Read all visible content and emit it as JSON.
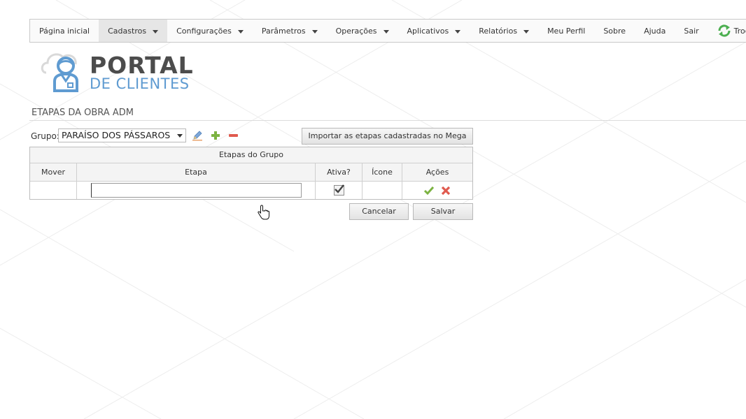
{
  "nav": {
    "items": [
      {
        "label": "Página inicial",
        "caret": false,
        "active": false
      },
      {
        "label": "Cadastros",
        "caret": true,
        "active": true
      },
      {
        "label": "Configurações",
        "caret": true,
        "active": false
      },
      {
        "label": "Parâmetros",
        "caret": true,
        "active": false
      },
      {
        "label": "Operações",
        "caret": true,
        "active": false
      },
      {
        "label": "Aplicativos",
        "caret": true,
        "active": false
      },
      {
        "label": "Relatórios",
        "caret": true,
        "active": false
      },
      {
        "label": "Meu Perfil",
        "caret": false,
        "active": false
      },
      {
        "label": "Sobre",
        "caret": false,
        "active": false
      },
      {
        "label": "Ajuda",
        "caret": false,
        "active": false
      },
      {
        "label": "Sair",
        "caret": false,
        "active": false
      }
    ],
    "switch_label": "Trocar P"
  },
  "logo": {
    "line1": "PORTAL",
    "line2": "DE CLIENTES"
  },
  "page": {
    "title": "ETAPAS DA OBRA ADM"
  },
  "group": {
    "label": "Grupo:",
    "selected": "PARAÍSO DOS PÁSSAROS",
    "import_button": "Importar as etapas cadastradas no Mega"
  },
  "grid": {
    "caption": "Etapas do Grupo",
    "columns": {
      "mover": "Mover",
      "etapa": "Etapa",
      "ativa": "Ativa?",
      "icone": "Ícone",
      "acoes": "Ações"
    },
    "row": {
      "etapa_value": "",
      "ativa_checked": true
    }
  },
  "buttons": {
    "cancel": "Cancelar",
    "save": "Salvar"
  },
  "colors": {
    "accent_blue": "#5f9bd1",
    "confirm_green": "#7cb342",
    "delete_red": "#e05a4e"
  }
}
